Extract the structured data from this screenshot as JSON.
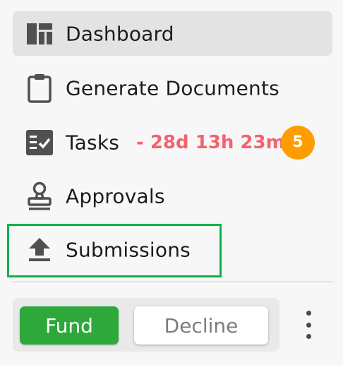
{
  "nav": {
    "items": [
      {
        "label": "Dashboard",
        "icon": "dashboard-icon",
        "active": true
      },
      {
        "label": "Generate Documents",
        "icon": "clipboard-icon"
      },
      {
        "label": "Tasks",
        "icon": "tasks-icon",
        "timer": "- 28d 13h 23m",
        "badge": "5"
      },
      {
        "label": "Approvals",
        "icon": "stamp-icon"
      },
      {
        "label": "Submissions",
        "icon": "upload-icon",
        "highlighted": true
      }
    ]
  },
  "actions": {
    "fund_label": "Fund",
    "decline_label": "Decline",
    "more_icon": "more-vertical-icon"
  },
  "colors": {
    "active_bg": "#e3e3e3",
    "timer": "#f2636e",
    "badge": "#ff9d00",
    "highlight": "#0db14b",
    "fund": "#2ea83a"
  }
}
